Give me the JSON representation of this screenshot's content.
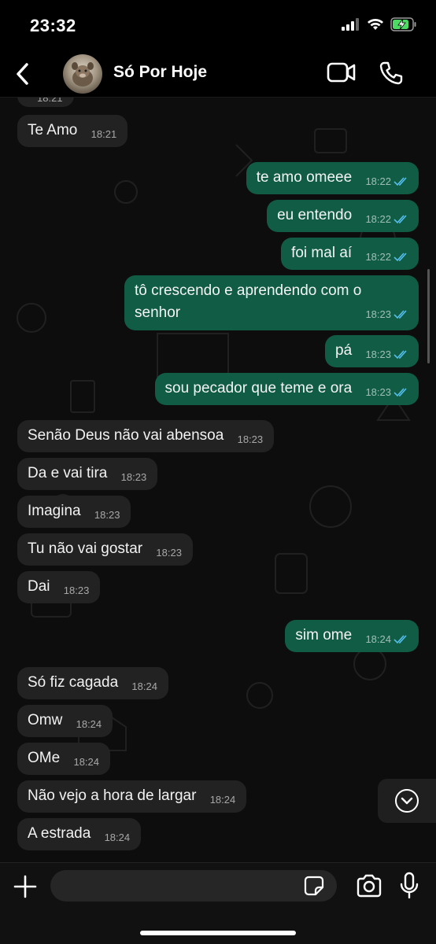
{
  "status_bar": {
    "time": "23:32",
    "icons": [
      "signal-icon",
      "wifi-icon",
      "battery-charging-icon"
    ],
    "battery_color": "#4cd964"
  },
  "header": {
    "back_icon": "chevron-left-icon",
    "contact_name": "Só Por Hoje",
    "video_icon": "video-camera-icon",
    "call_icon": "phone-icon"
  },
  "colors": {
    "incoming_bubble": "#222222",
    "outgoing_bubble": "#105c44",
    "read_ticks": "#53bdeb",
    "chat_background": "#0d0d0d"
  },
  "messages": [
    {
      "direction": "in",
      "text": "",
      "time": "18:21",
      "partial": true
    },
    {
      "direction": "in",
      "text": "Te Amo",
      "time": "18:21"
    },
    {
      "direction": "out",
      "text": "te amo omeee",
      "time": "18:22",
      "status": "read"
    },
    {
      "direction": "out",
      "text": "eu entendo",
      "time": "18:22",
      "status": "read"
    },
    {
      "direction": "out",
      "text": "foi mal aí",
      "time": "18:22",
      "status": "read"
    },
    {
      "direction": "out",
      "text": "tô crescendo e aprendendo com o senhor",
      "time": "18:23",
      "status": "read"
    },
    {
      "direction": "out",
      "text": "pá",
      "time": "18:23",
      "status": "read"
    },
    {
      "direction": "out",
      "text": "sou pecador que teme e ora",
      "time": "18:23",
      "status": "read"
    },
    {
      "direction": "in",
      "text": "Senão Deus não vai abensoa",
      "time": "18:23"
    },
    {
      "direction": "in",
      "text": "Da e vai tira",
      "time": "18:23"
    },
    {
      "direction": "in",
      "text": "Imagina",
      "time": "18:23"
    },
    {
      "direction": "in",
      "text": "Tu não vai gostar",
      "time": "18:23"
    },
    {
      "direction": "in",
      "text": "Dai",
      "time": "18:23"
    },
    {
      "direction": "out",
      "text": "sim ome",
      "time": "18:24",
      "status": "read"
    },
    {
      "direction": "in",
      "text": "Só fiz cagada",
      "time": "18:24"
    },
    {
      "direction": "in",
      "text": "Omw",
      "time": "18:24"
    },
    {
      "direction": "in",
      "text": "OMe",
      "time": "18:24"
    },
    {
      "direction": "in",
      "text": "Não vejo a hora de largar",
      "time": "18:24"
    },
    {
      "direction": "in",
      "text": "A estrada",
      "time": "18:24"
    }
  ],
  "scroll_down_icon": "chevron-down-circle-icon",
  "input_bar": {
    "plus_icon": "plus-icon",
    "input_value": "",
    "sticker_icon": "sticker-icon",
    "camera_icon": "camera-icon",
    "mic_icon": "microphone-icon"
  }
}
